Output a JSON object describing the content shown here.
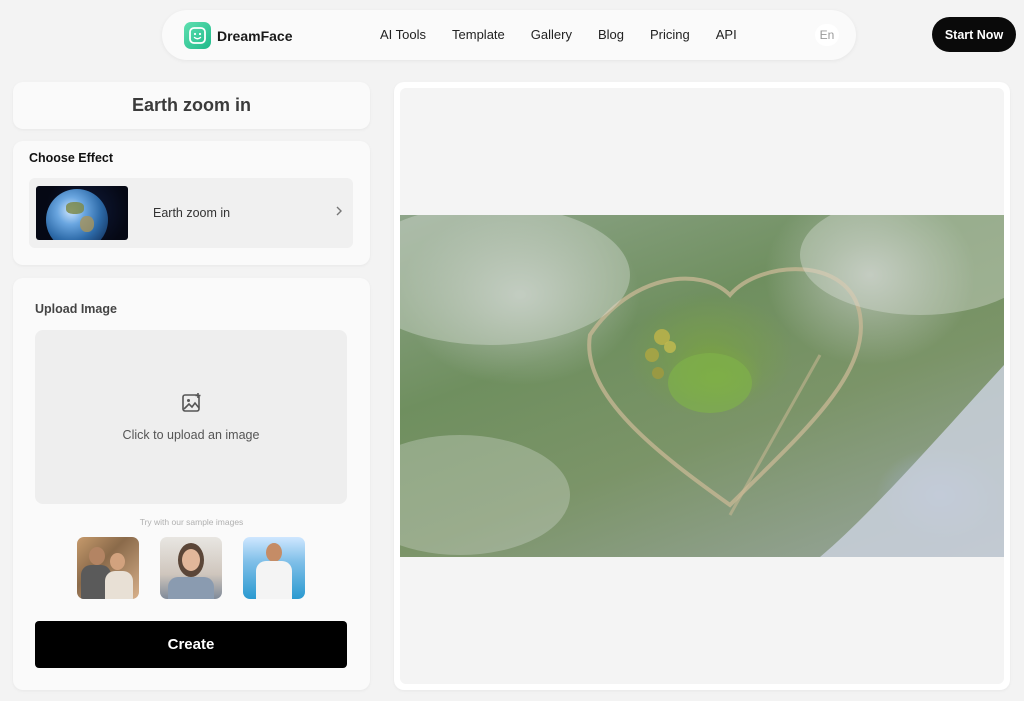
{
  "header": {
    "brand": "DreamFace",
    "nav": [
      "AI Tools",
      "Template",
      "Gallery",
      "Blog",
      "Pricing",
      "API"
    ],
    "language": "En",
    "cta": "Start Now"
  },
  "effect_panel": {
    "title": "Earth zoom in",
    "choose_effect_label": "Choose Effect",
    "selected_effect": "Earth zoom in"
  },
  "upload_panel": {
    "title": "Upload Image",
    "dropzone_text": "Click to upload an image",
    "sample_hint": "Try with our sample images",
    "create_label": "Create"
  },
  "colors": {
    "accent": "#1fb98a",
    "button_dark": "#000000",
    "page_bg": "#f3f3f3"
  }
}
